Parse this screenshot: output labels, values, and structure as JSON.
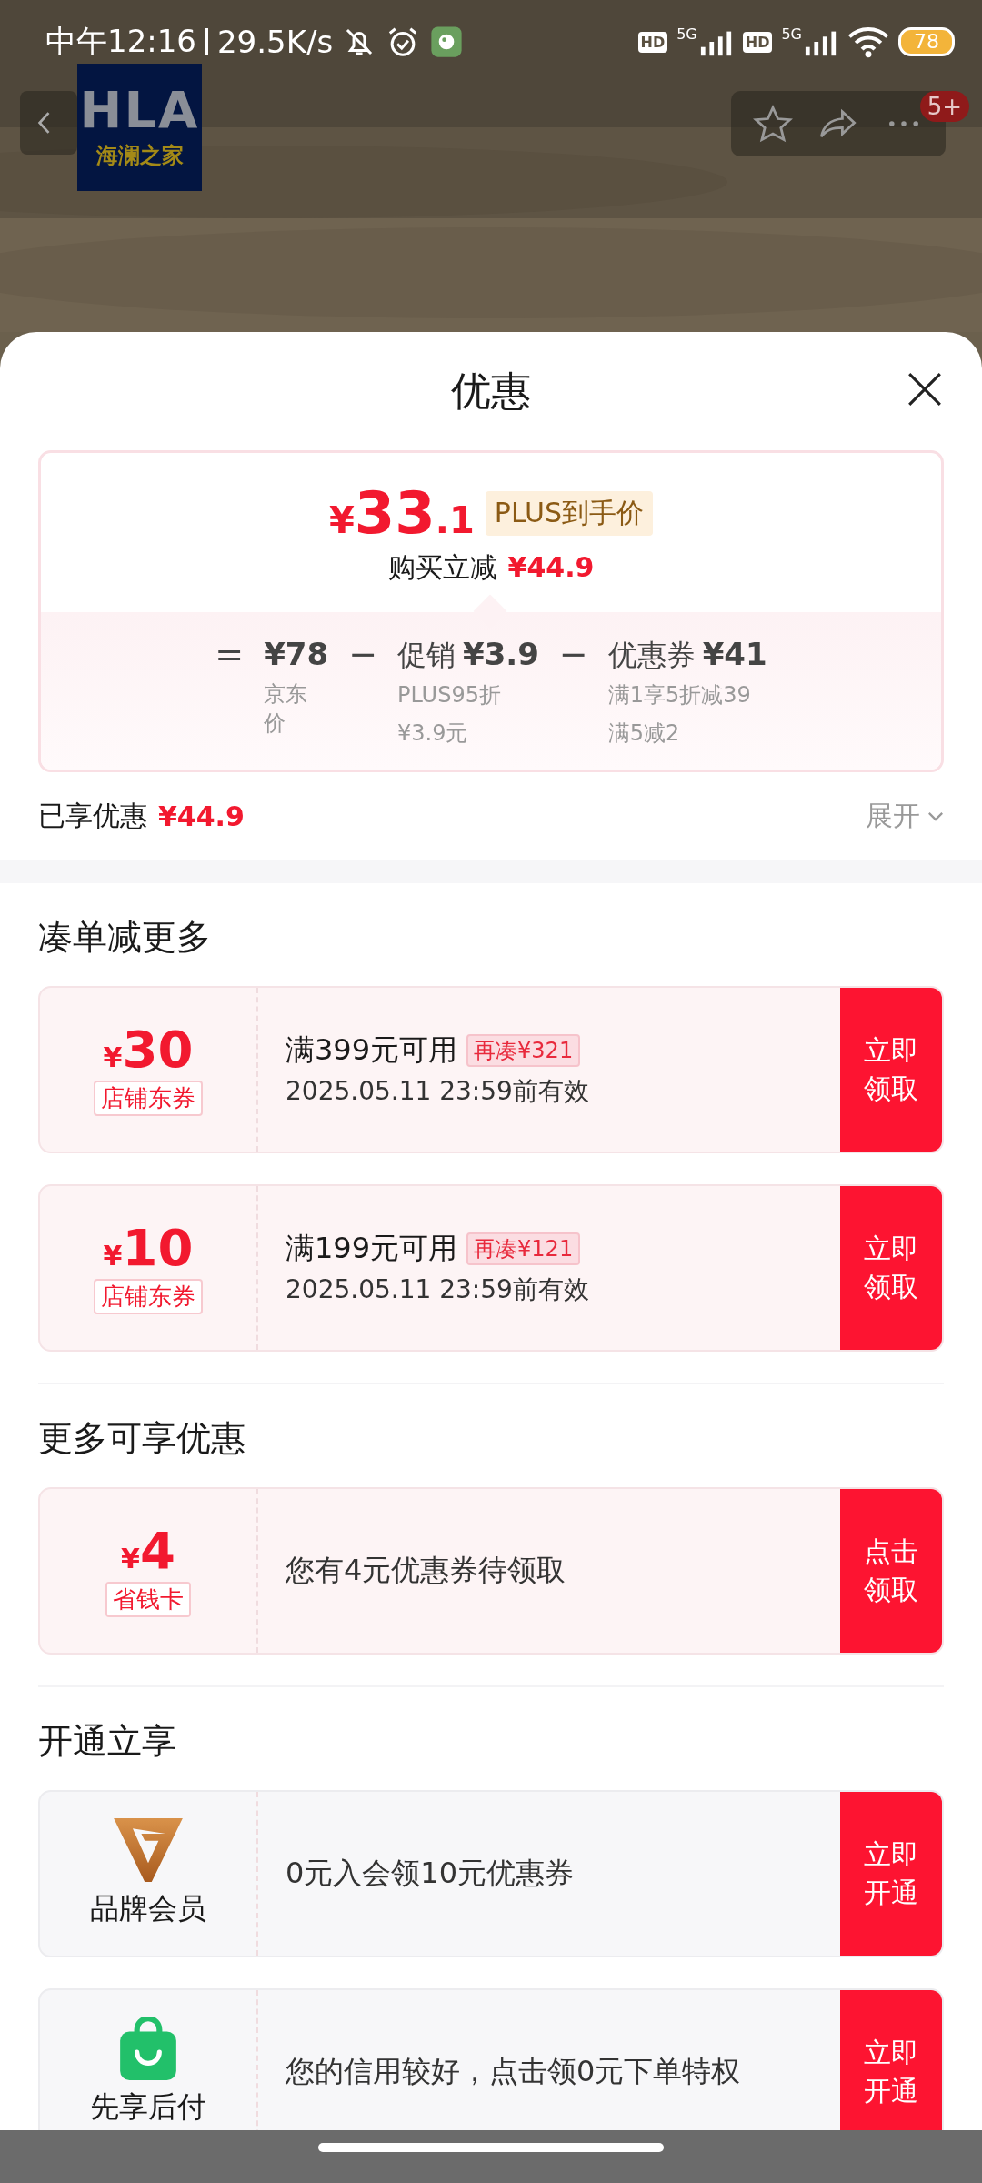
{
  "status_bar": {
    "time": "中午12:16",
    "speed": "29.5K/s",
    "battery": "78",
    "networks": [
      {
        "hd": "HD",
        "type": "5G"
      },
      {
        "hd": "HD",
        "type": "5G"
      }
    ]
  },
  "header": {
    "logo": {
      "latin": "HLA",
      "chinese": "海澜之家"
    },
    "badge": "5+"
  },
  "sheet": {
    "title": "优惠",
    "price_card": {
      "symbol": "¥",
      "integer": "33",
      "decimal": ".1",
      "tag": "PLUS到手价",
      "saving_label": "购买立减",
      "saving": "¥44.9",
      "terms": [
        {
          "op": "=",
          "amount": "¥78",
          "notes": [
            "京东价"
          ]
        },
        {
          "op": "−",
          "label": "促销",
          "amount": "¥3.9",
          "notes": [
            "PLUS95折",
            "¥3.9元"
          ]
        },
        {
          "op": "−",
          "label": "优惠券",
          "amount": "¥41",
          "notes": [
            "满1享5折减39",
            "满5减2"
          ]
        }
      ]
    },
    "summary": {
      "label": "已享优惠",
      "amount": "¥44.9",
      "toggle": "展开",
      "expanded": false
    },
    "sections": [
      {
        "title": "凑单减更多",
        "items": [
          {
            "kind": "coupon",
            "symbol": "¥",
            "amount": "30",
            "tag": "店铺东券",
            "condition": "满399元可用",
            "hint": "再凑¥321",
            "validity": "2025.05.11 23:59前有效",
            "action": "立即领取"
          },
          {
            "kind": "coupon",
            "symbol": "¥",
            "amount": "10",
            "tag": "店铺东券",
            "condition": "满199元可用",
            "hint": "再凑¥121",
            "validity": "2025.05.11 23:59前有效",
            "action": "立即领取"
          }
        ]
      },
      {
        "title": "更多可享优惠",
        "items": [
          {
            "kind": "coupon",
            "symbol": "¥",
            "amount": "4",
            "tag": "省钱卡",
            "description": "您有4元优惠券待领取",
            "action": "点击领取"
          }
        ]
      },
      {
        "title": "开通立享",
        "items": [
          {
            "kind": "membership",
            "label": "品牌会员",
            "description": "0元入会领10元优惠券",
            "action": "立即开通"
          },
          {
            "kind": "paylater",
            "label": "先享后付",
            "description": "您的信用较好，点击领0元下单特权",
            "action": "立即开通"
          }
        ]
      }
    ]
  }
}
